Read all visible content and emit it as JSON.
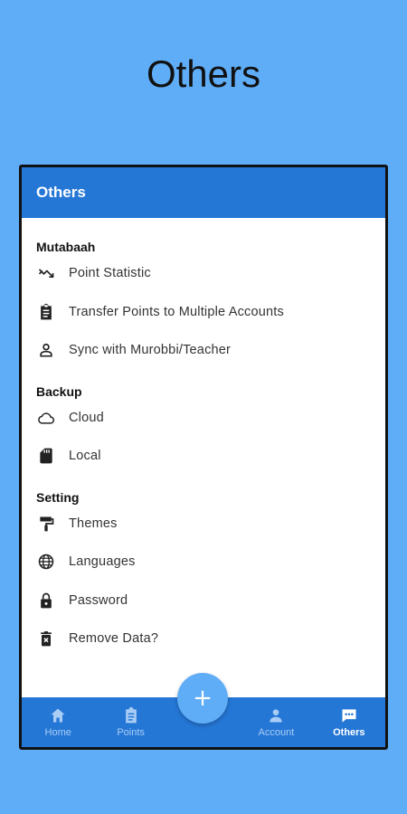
{
  "page_heading": "Others",
  "appbar": {
    "title": "Others"
  },
  "sections": [
    {
      "title": "Mutabaah",
      "items": [
        {
          "label": "Point Statistic",
          "icon": "trending-down-icon"
        },
        {
          "label": "Transfer Points to Multiple Accounts",
          "icon": "clipboard-icon"
        },
        {
          "label": "Sync with Murobbi/Teacher",
          "icon": "person-outline-icon"
        }
      ]
    },
    {
      "title": "Backup",
      "items": [
        {
          "label": "Cloud",
          "icon": "cloud-outline-icon"
        },
        {
          "label": "Local",
          "icon": "sd-card-icon"
        }
      ]
    },
    {
      "title": "Setting",
      "items": [
        {
          "label": "Themes",
          "icon": "paint-roller-icon"
        },
        {
          "label": "Languages",
          "icon": "globe-icon"
        },
        {
          "label": "Password",
          "icon": "lock-icon"
        },
        {
          "label": "Remove Data?",
          "icon": "delete-forever-icon"
        }
      ]
    }
  ],
  "bottom_nav": {
    "home": "Home",
    "points": "Points",
    "account": "Account",
    "others": "Others",
    "active": "Others"
  },
  "fab": {
    "symbol": "+"
  },
  "colors": {
    "background": "#5fadf7",
    "primary": "#2577d6",
    "nav_inactive": "#a9cdf5",
    "fab": "#5fadf7"
  }
}
